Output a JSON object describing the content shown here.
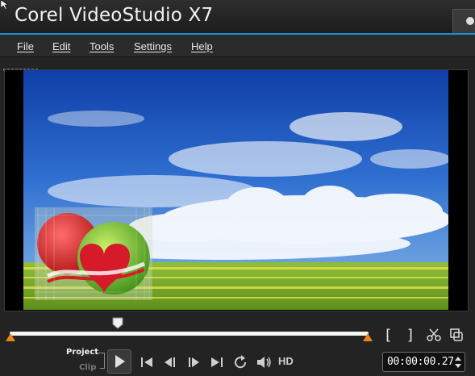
{
  "app": {
    "title": "Corel VideoStudio X7"
  },
  "menu": {
    "items": [
      {
        "id": "file",
        "label": "File"
      },
      {
        "id": "edit",
        "label": "Edit"
      },
      {
        "id": "tools",
        "label": "Tools"
      },
      {
        "id": "settings",
        "label": "Settings"
      },
      {
        "id": "help",
        "label": "Help"
      }
    ]
  },
  "player": {
    "mode_project_label": "Project",
    "mode_clip_label": "Clip",
    "active_mode": "Project",
    "hd_label": "HD",
    "timecode": "00:00:00.27",
    "scrubber_position": 0.3
  },
  "icons": {
    "mark_in": "mark-in-bracket-icon",
    "mark_out": "mark-out-bracket-icon",
    "split": "scissors-icon",
    "expand": "enlarge-preview-icon",
    "play": "play-icon",
    "home": "skip-to-start-icon",
    "prev_frame": "previous-frame-icon",
    "next_frame": "next-frame-icon",
    "end": "skip-to-end-icon",
    "repeat": "repeat-icon",
    "volume": "volume-icon"
  },
  "colors": {
    "accent": "#1e8fd6",
    "marker": "#e8841a",
    "background": "#232323"
  }
}
